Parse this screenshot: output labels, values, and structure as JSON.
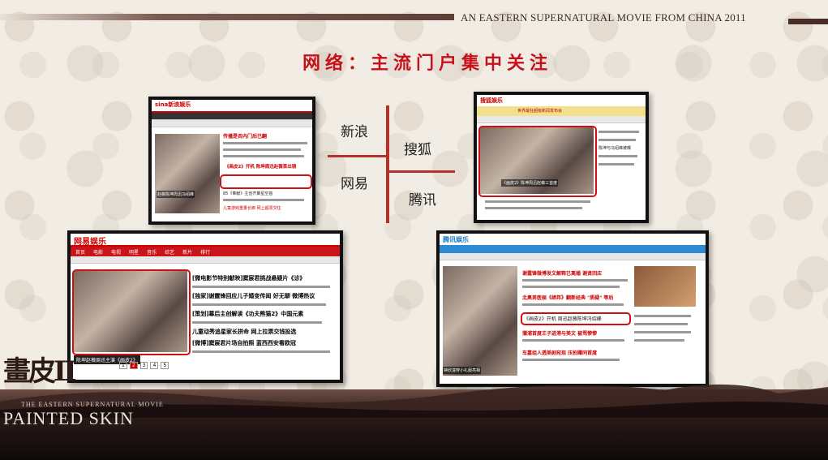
{
  "header": {
    "tagline": "AN EASTERN SUPERNATURAL MOVIE FROM CHINA  2011"
  },
  "title": "网络：主流门户集中关注",
  "labels": {
    "sina": "新浪",
    "netease": "网易",
    "sohu": "搜狐",
    "tencent": "腾讯"
  },
  "shots": {
    "sina": {
      "logo": "sina新浪娱乐",
      "headline1": "传播是否内门后已翻",
      "headline2": "《画皮2》开机 陈坤周迅赵薇首出镜",
      "caption": "赵薇陈坤周迅冯绍峰",
      "item": "85《奉献》主创齐聚星空首",
      "item2": "儿童游戏重量长廊 网上超票交往"
    },
    "sohu": {
      "logo": "搜狐娱乐",
      "banner": "世界最狂超级新闻发布会",
      "headline": "《画皮2》陈坤周迅赵薇三首度",
      "caption": "陈坤与冯绍峰被曝"
    },
    "netease": {
      "logo": "网易娱乐",
      "nav_items": [
        "首页",
        "电影",
        "电视",
        "明星",
        "音乐",
        "综艺",
        "新片",
        "排行"
      ],
      "headline": "[微电影节特别献映]窦宸君挑战悬疑片《诊》",
      "line2": "[独家]谢霆锋回应儿子婚变传闻 好无聊 微博热议",
      "line3": "[策划]幕后主创解读《功夫熊猫2》中国元素",
      "line4": "儿童动秀追星家长拼命 网上拉票交钱投选",
      "line5": "[微博]窦宸君片场自拍照 蓝西西安看欧冠",
      "caption": "陈坤赵薇周迅主演《画皮2》",
      "pager": [
        "1",
        "2",
        "3",
        "4",
        "5"
      ]
    },
    "tencent": {
      "logo": "腾讯娱乐",
      "headline": "谢霆锋微博发文解释已离婚 谢贤回应",
      "line2": "北奥男医娱《缔邦》翻新经典 \"质疑\" 等后",
      "line3": "蒲浦首度王子进港与美文 被骂惨惨",
      "highlight": "《画皮2》开机 周迅赵薇陈坤冯绍峰",
      "line4": "车嘉组人透美剧宛现 压拍赚同首度",
      "caption": "钟欣潼穿小礼服亮相"
    }
  },
  "brand": {
    "chinese": "畫皮II",
    "subtitle": "THE EASTERN SUPERNATURAL MOVIE",
    "english": "PAINTED SKIN"
  }
}
